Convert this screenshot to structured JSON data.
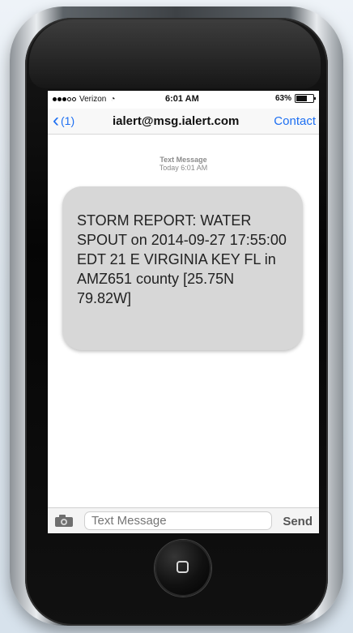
{
  "status_bar": {
    "carrier": "Verizon",
    "time": "6:01 AM",
    "battery": "63%"
  },
  "nav": {
    "back_label": "(1)",
    "title": "ialert@msg.ialert.com",
    "contact_label": "Contact"
  },
  "conversation": {
    "header_label": "Text Message",
    "header_time": "Today 6:01 AM",
    "message": "STORM REPORT: WATER SPOUT on 2014-09-27 17:55:00 EDT 21 E VIRGINIA KEY FL in AMZ651 county [25.75N 79.82W]"
  },
  "composer": {
    "placeholder": "Text Message",
    "send_label": "Send"
  },
  "icons": {
    "back": "chevron-left-icon",
    "camera": "camera-icon",
    "wifi": "wifi-icon",
    "battery": "battery-icon",
    "home": "home-button-icon"
  },
  "colors": {
    "accent": "#1d6ff2",
    "bubble": "#d7d7d7"
  }
}
